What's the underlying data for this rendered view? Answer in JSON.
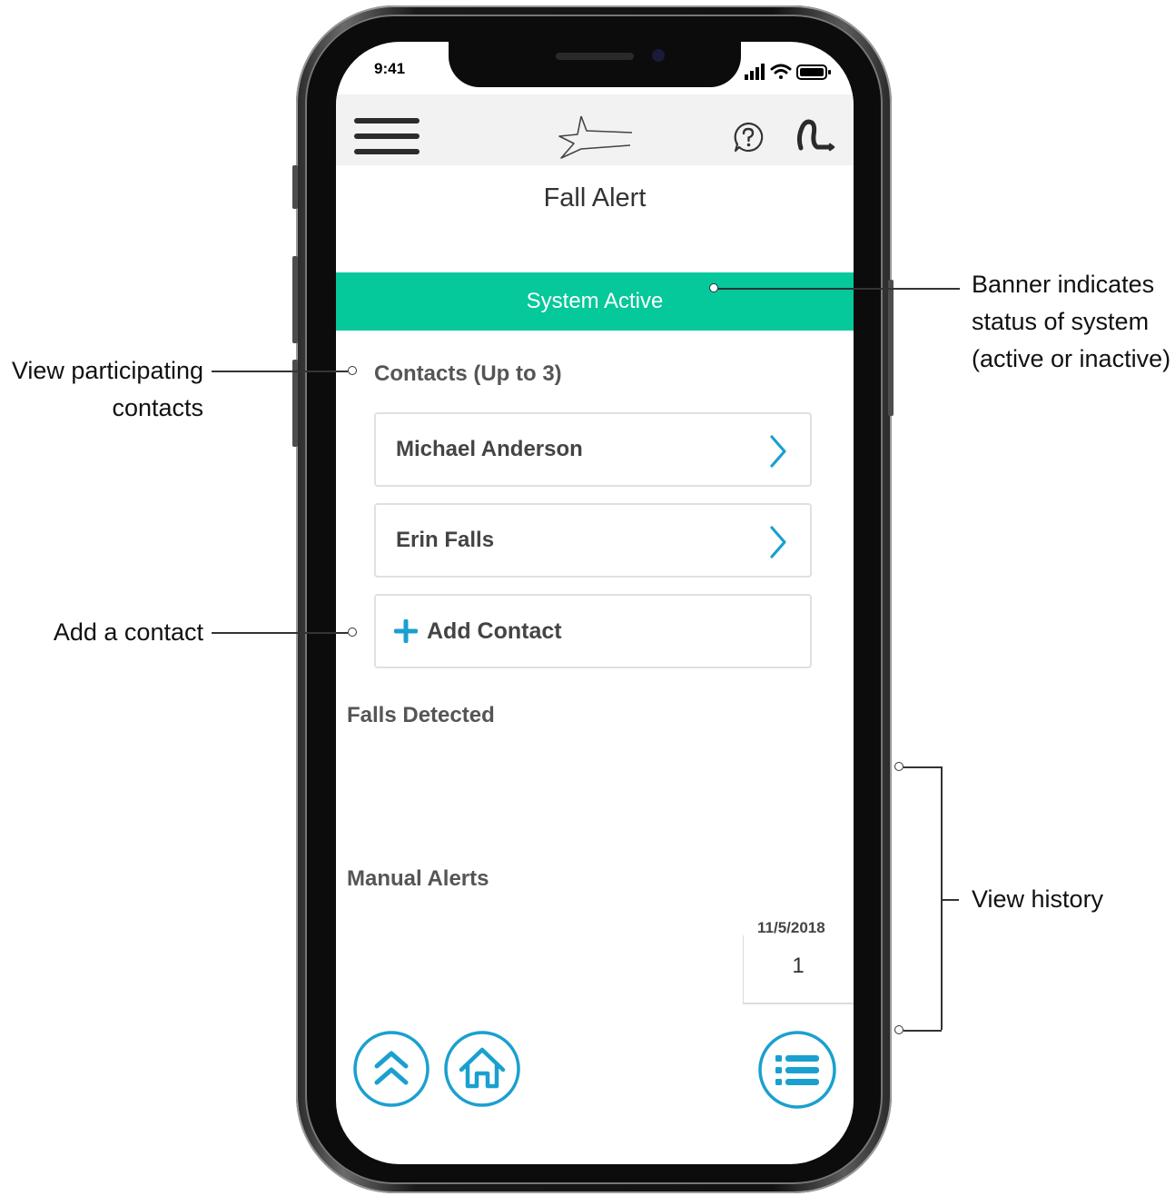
{
  "status_bar": {
    "time": "9:41"
  },
  "header": {
    "menu_icon": "hamburger-icon",
    "logo_icon": "star-logo-icon",
    "help_icon": "question-icon",
    "hearing_aid_icon": "hearing-aid-icon"
  },
  "page": {
    "title": "Fall Alert"
  },
  "banner": {
    "text": "System Active",
    "color": "#05c89b"
  },
  "contacts": {
    "label": "Contacts (Up to 3)",
    "items": [
      {
        "name": "Michael Anderson"
      },
      {
        "name": "Erin Falls"
      }
    ],
    "add_label": "Add Contact"
  },
  "falls_detected": {
    "label": "Falls Detected"
  },
  "manual_alerts": {
    "label": "Manual Alerts",
    "history": {
      "date": "11/5/2018",
      "count": "1"
    }
  },
  "bottom_nav": {
    "up_icon": "double-chevron-up-icon",
    "home_icon": "home-icon",
    "list_icon": "list-icon"
  },
  "accent_color": "#1aa0cf",
  "annotations": {
    "banner_note": [
      "Banner indicates",
      "status of system",
      "(active or inactive)"
    ],
    "contacts_note": [
      "View participating",
      "contacts"
    ],
    "add_note": "Add a contact",
    "history_note": "View history"
  }
}
